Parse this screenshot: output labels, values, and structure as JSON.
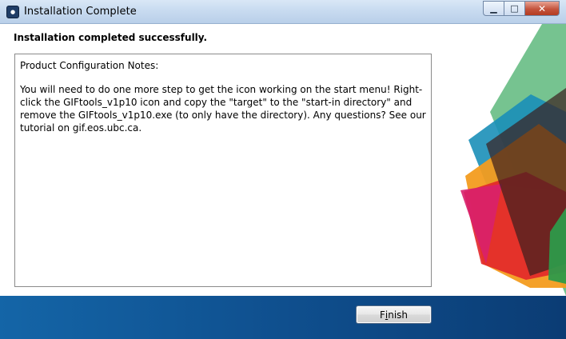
{
  "window": {
    "title": "Installation Complete",
    "controls": {
      "minimize_glyph": "▁",
      "maximize_glyph": "□",
      "close_glyph": "✕"
    }
  },
  "content": {
    "heading": "Installation completed successfully.",
    "notes_title": "Product Configuration Notes:",
    "notes_body": "You will need to do one more step to get the icon working on the start menu! Right-click the GIFtools_v1p10 icon and copy the \"target\" to the \"start-in directory\" and remove the GIFtools_v1p10.exe (to only have the directory). Any questions? See our tutorial on gif.eos.ubc.ca."
  },
  "footer": {
    "finish_label_prefix": "F",
    "finish_label_underlined": "i",
    "finish_label_rest": "nish"
  },
  "colors": {
    "footer_blue": "#0f4f8e",
    "art_green": "#6fc08a",
    "art_orange": "#f39c1f",
    "art_teal": "#1b8fb8",
    "art_red": "#e2262a",
    "art_magenta": "#d8206b",
    "art_dark": "#3a1e1e"
  }
}
